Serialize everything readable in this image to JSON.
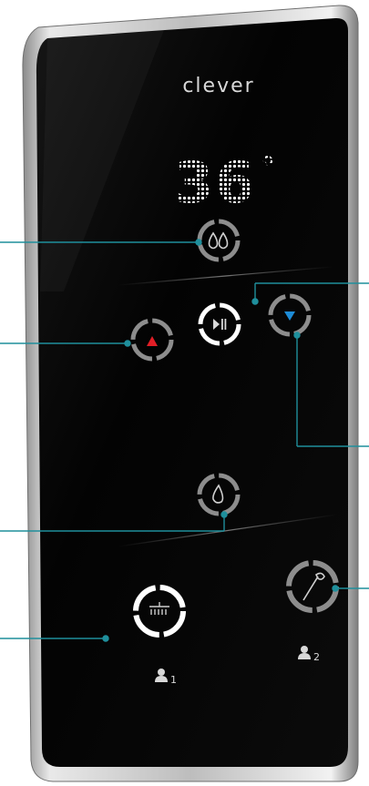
{
  "device": {
    "brand": "clever",
    "temperature": "36",
    "unit_symbol": "°",
    "colors": {
      "frame": "#c9c9c9",
      "glass": "#050505",
      "callout": "#1f8f9c",
      "ring": "#9a9a9a",
      "ring_active": "#ffffff",
      "temp_up": "#e21e26",
      "temp_down": "#1d8bd6"
    },
    "buttons": {
      "flow_up_icon": "double-drop-icon",
      "temp_up_icon": "red-triangle-up-icon",
      "play_pause_icon": "play-pause-icon",
      "temp_down_icon": "blue-triangle-down-icon",
      "flow_down_icon": "single-drop-icon",
      "outlet_1_icon": "rain-shower-head-icon",
      "outlet_2_icon": "hand-shower-icon"
    },
    "users": {
      "user_1": "1",
      "user_2": "2"
    }
  }
}
